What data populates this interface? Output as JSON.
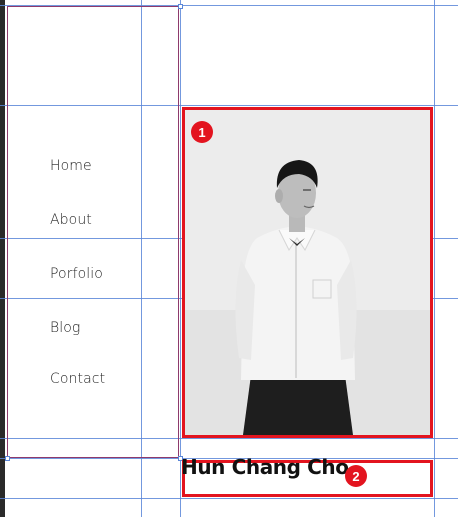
{
  "nav": {
    "items": [
      {
        "label": "Home"
      },
      {
        "label": "About"
      },
      {
        "label": "Porfolio"
      },
      {
        "label": "Blog"
      },
      {
        "label": "Contact"
      }
    ]
  },
  "profile": {
    "name": "Hun Chang Cho"
  },
  "annotations": {
    "photo_badge": "1",
    "name_badge": "2"
  },
  "colors": {
    "highlight": "#e3141f",
    "guide": "#5a86d8",
    "frame": "#8e3a6c"
  }
}
